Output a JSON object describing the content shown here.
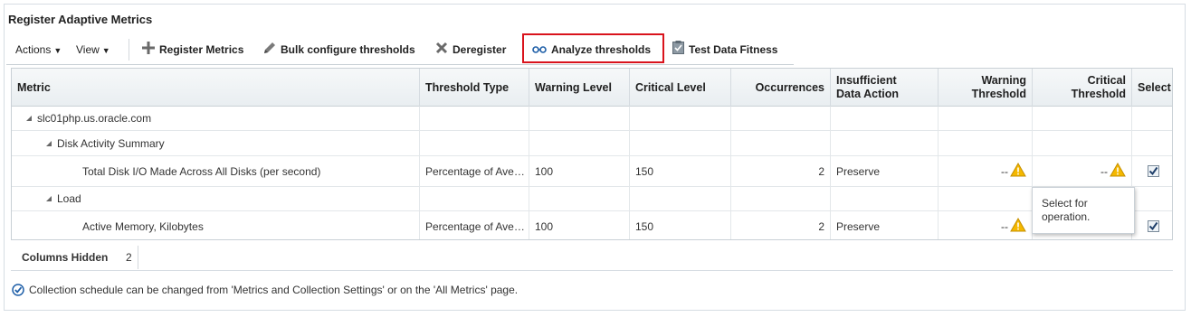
{
  "page": {
    "title": "Register Adaptive Metrics"
  },
  "toolbar": {
    "actions_label": "Actions",
    "view_label": "View",
    "register_label": "Register Metrics",
    "bulk_label": "Bulk configure thresholds",
    "deregister_label": "Deregister",
    "analyze_label": "Analyze thresholds",
    "fitness_label": "Test Data Fitness"
  },
  "table": {
    "headers": {
      "metric": "Metric",
      "threshold_type": "Threshold Type",
      "warning_level": "Warning Level",
      "critical_level": "Critical Level",
      "occurrences": "Occurrences",
      "insufficient_line1": "Insufficient",
      "insufficient_line2": "Data Action",
      "warning_threshold_line1": "Warning",
      "warning_threshold_line2": "Threshold",
      "critical_threshold_line1": "Critical",
      "critical_threshold_line2": "Threshold",
      "select": "Select"
    },
    "rows": [
      {
        "label": "slc01php.us.oracle.com"
      },
      {
        "label": "Disk Activity Summary"
      },
      {
        "label": "Total Disk I/O Made Across All Disks (per second)",
        "threshold_type": "Percentage of Ave…",
        "warning_level": "100",
        "critical_level": "150",
        "occurrences": "2",
        "insufficient": "Preserve",
        "warning_threshold": "--",
        "critical_threshold": "--",
        "selected": true
      },
      {
        "label": "Load"
      },
      {
        "label": "Active Memory, Kilobytes",
        "threshold_type": "Percentage of Ave…",
        "warning_level": "100",
        "critical_level": "150",
        "occurrences": "2",
        "insufficient": "Preserve",
        "warning_threshold": "--",
        "selected": true
      }
    ]
  },
  "tooltip": {
    "line1": "Select for",
    "line2": "operation."
  },
  "footer": {
    "columns_hidden_label": "Columns Hidden",
    "columns_hidden_value": "2",
    "info_text": "Collection schedule can be changed from 'Metrics and Collection Settings' or on the 'All Metrics' page."
  },
  "colors": {
    "highlight": "#d9131c",
    "warning_icon": "#f5b800",
    "accent": "#1f5fa8"
  },
  "icons": [
    "plus-icon",
    "pencil-icon",
    "x-icon",
    "glasses-icon",
    "clipboard-check-icon",
    "warning-icon",
    "checkmark-circle-icon",
    "tree-collapse-icon",
    "checkbox-icon"
  ]
}
